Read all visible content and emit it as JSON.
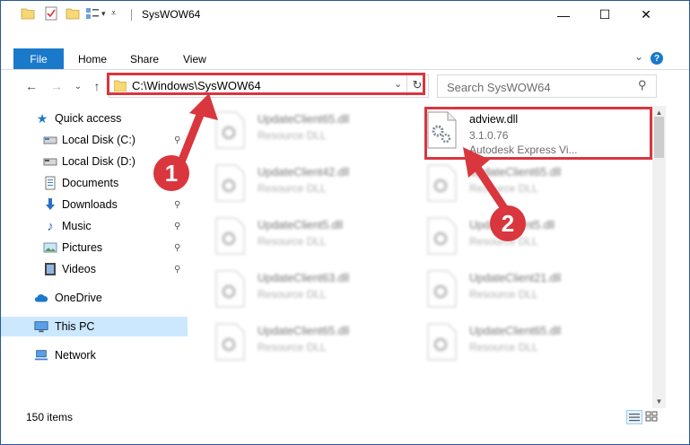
{
  "window": {
    "title": "SysWOW64",
    "minimize_glyph": "—",
    "maximize_glyph": "☐",
    "close_glyph": "✕"
  },
  "ribbon": {
    "tabs": [
      "File",
      "Home",
      "Share",
      "View"
    ],
    "expand_glyph": "⌄",
    "help_glyph": "?"
  },
  "nav": {
    "back_glyph": "←",
    "forward_glyph": "→",
    "recent_glyph": "⌄",
    "up_glyph": "↑",
    "address_path": "C:\\Windows\\SysWOW64",
    "address_dropdown_glyph": "⌄",
    "refresh_glyph": "↻",
    "search_placeholder": "Search SysWOW64",
    "search_glyph": "⚲"
  },
  "sidebar": {
    "items": [
      {
        "label": "Quick access",
        "icon": "star-icon",
        "pinned": false
      },
      {
        "label": "Local Disk (C:)",
        "icon": "drive-icon",
        "pinned": true
      },
      {
        "label": "Local Disk (D:)",
        "icon": "drive-icon",
        "pinned": true
      },
      {
        "label": "Documents",
        "icon": "documents-icon",
        "pinned": true
      },
      {
        "label": "Downloads",
        "icon": "download-icon",
        "pinned": true
      },
      {
        "label": "Music",
        "icon": "music-icon",
        "pinned": true
      },
      {
        "label": "Pictures",
        "icon": "pictures-icon",
        "pinned": true
      },
      {
        "label": "Videos",
        "icon": "videos-icon",
        "pinned": true
      },
      {
        "label": "OneDrive",
        "icon": "cloud-icon",
        "pinned": false
      },
      {
        "label": "This PC",
        "icon": "computer-icon",
        "pinned": false,
        "selected": true
      },
      {
        "label": "Network",
        "icon": "network-icon",
        "pinned": false
      }
    ],
    "pin_glyph": "📌"
  },
  "files": {
    "left_column": [
      {
        "name": "UpdateClient65.dll",
        "type": "Resource DLL"
      },
      {
        "name": "UpdateClient42.dll",
        "type": "Resource DLL"
      },
      {
        "name": "UpdateClient5.dll",
        "type": "Resource DLL"
      },
      {
        "name": "UpdateClient63.dll",
        "type": "Resource DLL"
      },
      {
        "name": "UpdateClient65.dll",
        "type": "Resource DLL"
      }
    ],
    "right_column": [
      {
        "name": "adview.dll",
        "version": "3.1.0.76",
        "description": "Autodesk Express Vi...",
        "highlighted": true
      },
      {
        "name": "UpdateClient65.dll",
        "type": "Resource DLL"
      },
      {
        "name": "UpdateClient5.dll",
        "type": "Resource DLL"
      },
      {
        "name": "UpdateClient21.dll",
        "type": "Resource DLL"
      },
      {
        "name": "UpdateClient65.dll",
        "type": "Resource DLL"
      }
    ]
  },
  "status": {
    "item_count": "150 items"
  },
  "annotations": {
    "callout_1": "1",
    "callout_2": "2",
    "color": "#d9363e"
  },
  "colors": {
    "accent": "#1979ca",
    "selection": "#cce8ff",
    "highlight": "#d9363e"
  }
}
